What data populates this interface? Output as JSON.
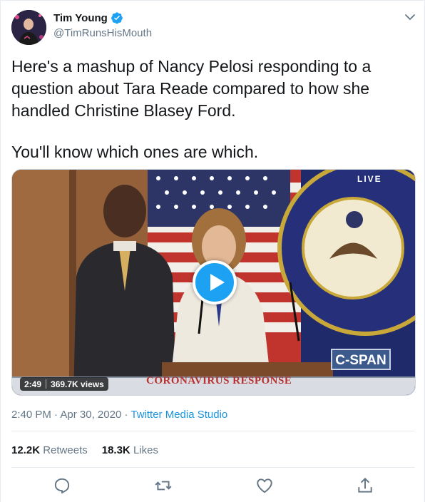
{
  "author": {
    "display_name": "Tim Young",
    "handle": "@TimRunsHisMouth",
    "verified": true,
    "avatar_icon": "user-avatar"
  },
  "tweet": {
    "paragraphs": [
      "Here's a mashup of Nancy Pelosi responding to a question about Tara Reade compared to how she handled Christine Blasey Ford.",
      "You'll know which ones are which."
    ]
  },
  "media": {
    "type": "video",
    "duration": "2:49",
    "views": "369.7K views",
    "live_label": "LIVE",
    "network_logo": "C-SPAN",
    "chyron": "CORONAVIRUS RESPONSE",
    "play_icon": "play-icon"
  },
  "meta": {
    "time": "2:40 PM",
    "separator": " · ",
    "date": "Apr 30, 2020",
    "source": "Twitter Media Studio"
  },
  "counts": {
    "retweets_value": "12.2K",
    "retweets_label": "Retweets",
    "likes_value": "18.3K",
    "likes_label": "Likes"
  },
  "actions": [
    {
      "icon": "reply-icon"
    },
    {
      "icon": "retweet-icon"
    },
    {
      "icon": "like-icon"
    },
    {
      "icon": "share-icon"
    }
  ],
  "colors": {
    "accent": "#1da1f2",
    "link": "#1b95e0",
    "secondary_text": "#657786",
    "primary_text": "#14171a"
  }
}
